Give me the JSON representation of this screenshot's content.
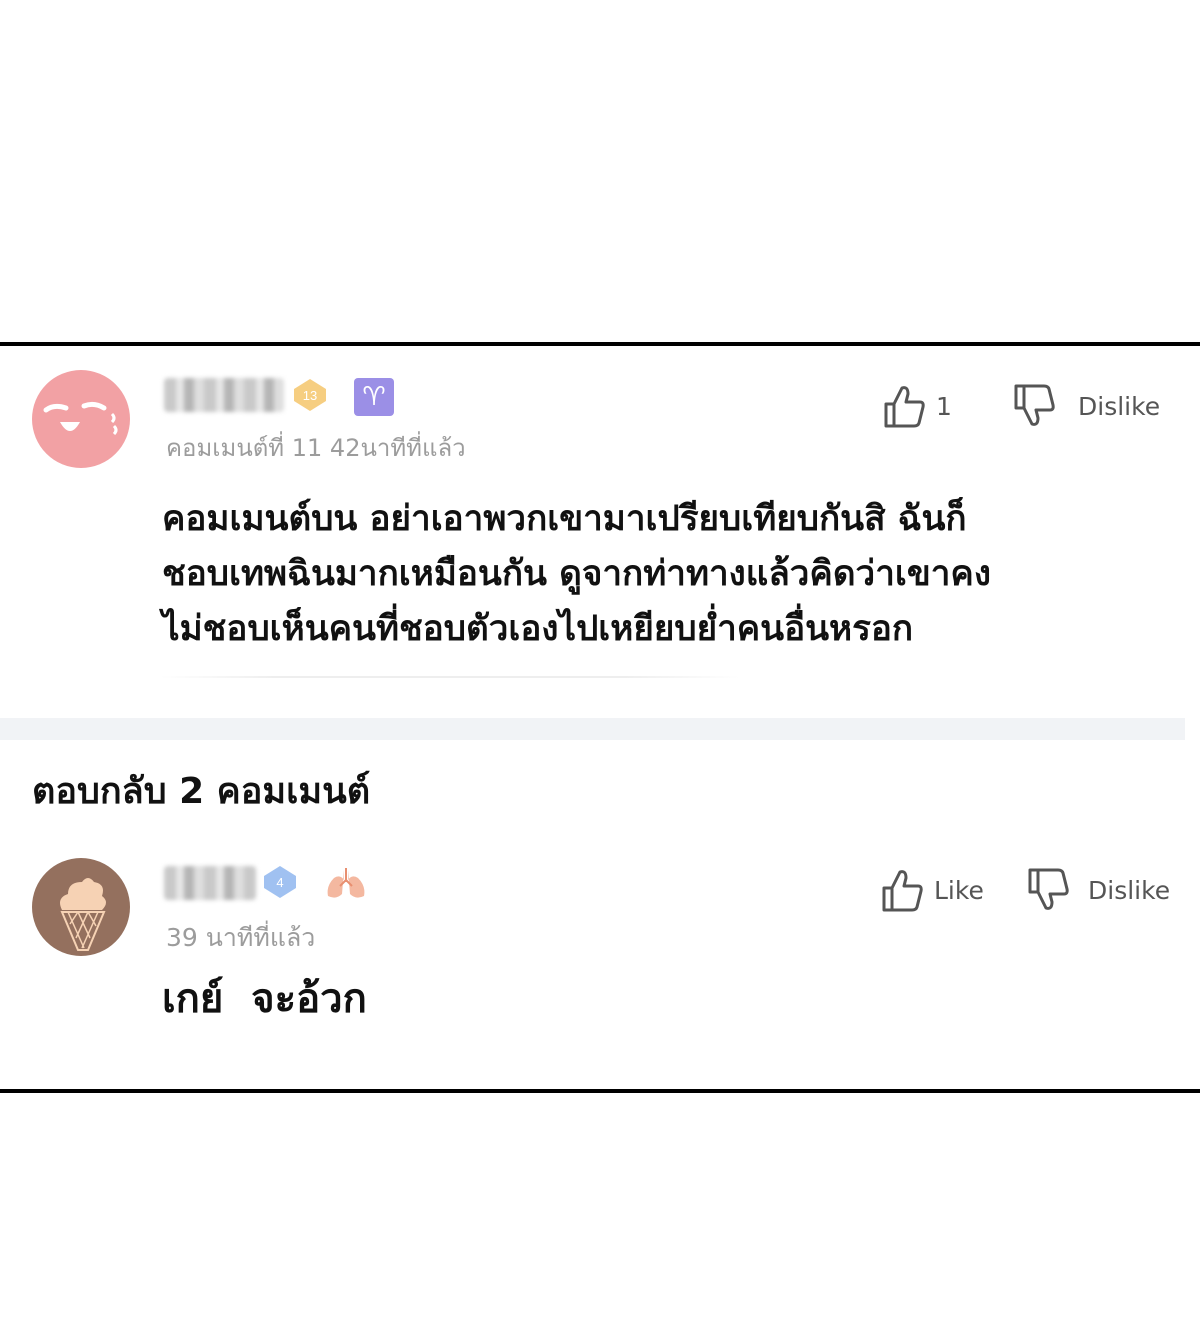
{
  "comment_main": {
    "badge_level": "13",
    "zodiac_symbol": "♈",
    "meta": "คอมเมนต์ที่ 11  42นาทีที่แล้ว",
    "lines": [
      "คอมเมนต์บน อย่าเอาพวกเขามาเปรียบเทียบกันสิ ฉันก็",
      "ชอบเทพฉินมากเหมือนกัน ดูจากท่าทางแล้วคิดว่าเขาคง",
      "ไม่ชอบเห็นคนที่ชอบตัวเองไปเหยียบย่ำคนอื่นหรอก"
    ],
    "like_count": "1",
    "dislike_label": "Dislike",
    "like_icon": "thumbs-up-icon",
    "dislike_icon": "thumbs-down-icon"
  },
  "replies_header": "ตอบกลับ 2 คอมเมนต์",
  "comment_reply": {
    "badge_level": "4",
    "meta": "39 นาทีที่แล้ว",
    "text": "เกย์  จะอ้วก",
    "like_label": "Like",
    "dislike_label": "Dislike"
  },
  "colors": {
    "avatar_main": "#f2a1a4",
    "avatar_reply": "#94705e",
    "badge_gold": "#f5c66b",
    "badge_blue": "#8fb6ef",
    "zodiac_bg": "#9b8fe6",
    "rule": "#000000"
  }
}
